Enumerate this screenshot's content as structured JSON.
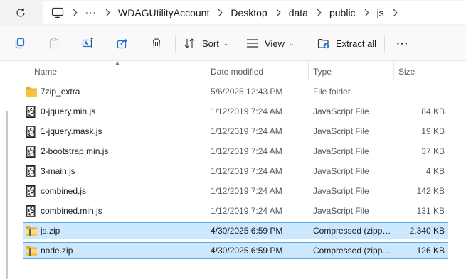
{
  "address_bar": {
    "crumbs": [
      "WDAGUtilityAccount",
      "Desktop",
      "data",
      "public",
      "js"
    ],
    "overflow_label": "···"
  },
  "toolbar": {
    "sort_label": "Sort",
    "view_label": "View",
    "extract_label": "Extract all",
    "more_label": "···"
  },
  "columns": {
    "name": "Name",
    "date": "Date modified",
    "type": "Type",
    "size": "Size"
  },
  "files": [
    {
      "name": "7zip_extra",
      "date": "5/6/2025 12:43 PM",
      "type": "File folder",
      "size": "",
      "icon": "folder-icon",
      "selected": false
    },
    {
      "name": "0-jquery.min.js",
      "date": "1/12/2019 7:24 AM",
      "type": "JavaScript File",
      "size": "84 KB",
      "icon": "script-file-icon",
      "selected": false
    },
    {
      "name": "1-jquery.mask.js",
      "date": "1/12/2019 7:24 AM",
      "type": "JavaScript File",
      "size": "19 KB",
      "icon": "script-file-icon",
      "selected": false
    },
    {
      "name": "2-bootstrap.min.js",
      "date": "1/12/2019 7:24 AM",
      "type": "JavaScript File",
      "size": "37 KB",
      "icon": "script-file-icon",
      "selected": false
    },
    {
      "name": "3-main.js",
      "date": "1/12/2019 7:24 AM",
      "type": "JavaScript File",
      "size": "4 KB",
      "icon": "script-file-icon",
      "selected": false
    },
    {
      "name": "combined.js",
      "date": "1/12/2019 7:24 AM",
      "type": "JavaScript File",
      "size": "142 KB",
      "icon": "script-file-icon",
      "selected": false
    },
    {
      "name": "combined.min.js",
      "date": "1/12/2019 7:24 AM",
      "type": "JavaScript File",
      "size": "131 KB",
      "icon": "script-file-icon",
      "selected": false
    },
    {
      "name": "js.zip",
      "date": "4/30/2025 6:59 PM",
      "type": "Compressed (zipp…",
      "size": "2,340 KB",
      "icon": "zip-folder-icon",
      "selected": true
    },
    {
      "name": "node.zip",
      "date": "4/30/2025 6:59 PM",
      "type": "Compressed (zipp…",
      "size": "126 KB",
      "icon": "zip-folder-icon",
      "selected": true
    }
  ],
  "colors": {
    "selection_bg": "#cce8ff",
    "selection_border": "#5aa8e6",
    "folder": "#f5c242"
  }
}
